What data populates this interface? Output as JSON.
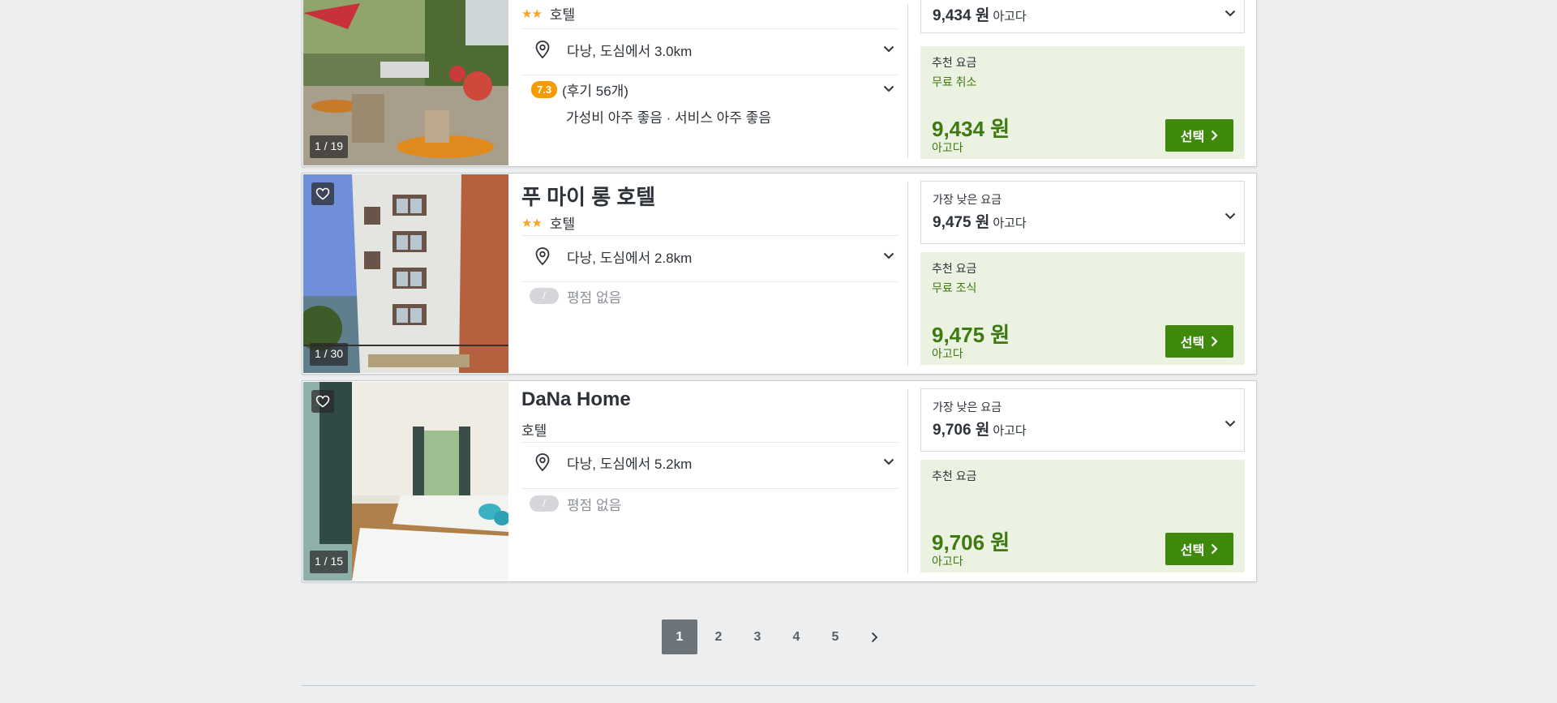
{
  "hotels": [
    {
      "name": "",
      "stars": "★★",
      "type": "호텔",
      "photo_counter": "1 / 19",
      "location": "다낭, 도심에서 3.0km",
      "score": "7.3",
      "review_count": "(후기 56개)",
      "review_summary": "가성비 아주 좋음 · 서비스 아주 좋음",
      "lowest_price_label": "",
      "lowest_price": "9,434 원",
      "lowest_price_source": "아고다",
      "recommended_label": "추천 요금",
      "recommended_perk": "무료 취소",
      "recommended_price": "9,434 원",
      "recommended_source": "아고다",
      "select_label": "선택"
    },
    {
      "name": "푸 마이 롱 호텔",
      "stars": "★★",
      "type": "호텔",
      "photo_counter": "1 / 30",
      "location": "다낭, 도심에서 2.8km",
      "no_rating_badge": "/",
      "no_rating_text": "평점 없음",
      "lowest_price_label": "가장 낮은 요금",
      "lowest_price": "9,475 원",
      "lowest_price_source": "아고다",
      "recommended_label": "추천 요금",
      "recommended_perk": "무료 조식",
      "recommended_price": "9,475 원",
      "recommended_source": "아고다",
      "select_label": "선택"
    },
    {
      "name": "DaNa Home",
      "type": "호텔",
      "photo_counter": "1 / 15",
      "location": "다낭, 도심에서 5.2km",
      "no_rating_badge": "/",
      "no_rating_text": "평점 없음",
      "lowest_price_label": "가장 낮은 요금",
      "lowest_price": "9,706 원",
      "lowest_price_source": "아고다",
      "recommended_label": "추천 요금",
      "recommended_perk": "",
      "recommended_price": "9,706 원",
      "recommended_source": "아고다",
      "select_label": "선택"
    }
  ],
  "pagination": {
    "pages": [
      "1",
      "2",
      "3",
      "4",
      "5"
    ],
    "current": "1"
  },
  "colors": {
    "accent_green": "#3f8a0c",
    "rating_orange": "#f59b00",
    "recommended_bg": "#ebf2e1"
  }
}
